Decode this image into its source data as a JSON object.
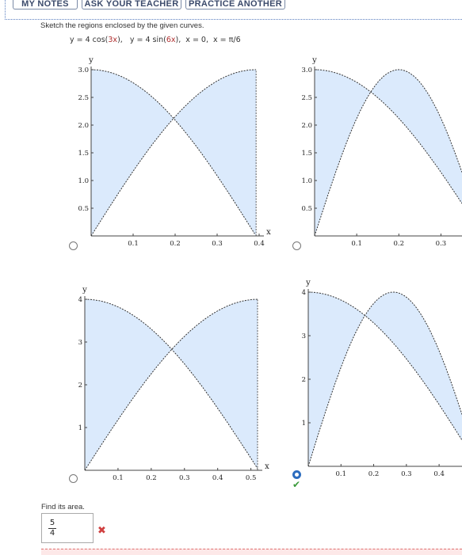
{
  "toolbar": {
    "my_notes_label": "MY NOTES",
    "ask_teacher_label": "ASK YOUR TEACHER",
    "practice_another_label": "PRACTICE ANOTHER"
  },
  "question": {
    "prompt": "Sketch the regions enclosed by the given curves.",
    "eq_y1": "y = 4 cos(",
    "eq_arg1": "3x",
    "eq_mid": "),   y = 4 sin(",
    "eq_arg2": "6x",
    "eq_rest": "),  x = 0,  x = π/6"
  },
  "options": [
    {
      "id": "a",
      "selected": false,
      "correct_mark": false,
      "chart_data": {
        "type": "area",
        "ylabel": "y",
        "xlabel": "x",
        "x_ticks": [
          "0.1",
          "0.2",
          "0.3",
          "0.4"
        ],
        "y_ticks": [
          "0.5",
          "1.0",
          "1.5",
          "2.0",
          "2.5",
          "3.0"
        ],
        "xlim": [
          0,
          0.4
        ],
        "ylim": [
          0,
          3
        ],
        "series": [
          {
            "fn": "3*cos(4x)",
            "period_scale": 4
          },
          {
            "fn": "3*sin(4x)"
          }
        ]
      }
    },
    {
      "id": "b",
      "selected": false,
      "correct_mark": false,
      "chart_data": {
        "type": "area",
        "ylabel": "y",
        "x_ticks": [
          "0.1",
          "0.2",
          "0.3"
        ],
        "y_ticks": [
          "0.5",
          "1.0",
          "1.5",
          "2.0",
          "2.5",
          "3.0"
        ],
        "xlim": [
          0,
          0.35
        ],
        "ylim": [
          0,
          3
        ]
      }
    },
    {
      "id": "c",
      "selected": false,
      "correct_mark": false,
      "chart_data": {
        "type": "area",
        "ylabel": "y",
        "xlabel": "x",
        "x_ticks": [
          "0.1",
          "0.2",
          "0.3",
          "0.4",
          "0.5"
        ],
        "y_ticks": [
          "1",
          "2",
          "3",
          "4"
        ],
        "xlim": [
          0,
          0.52
        ],
        "ylim": [
          0,
          4
        ]
      }
    },
    {
      "id": "d",
      "selected": true,
      "correct_mark": true,
      "chart_data": {
        "type": "area",
        "ylabel": "y",
        "x_ticks": [
          "0.1",
          "0.2",
          "0.3",
          "0.4"
        ],
        "y_ticks": [
          "1",
          "2",
          "3",
          "4"
        ],
        "xlim": [
          0,
          0.47
        ],
        "ylim": [
          0,
          4
        ]
      }
    }
  ],
  "area": {
    "label": "Find its area.",
    "answer_num": "5",
    "answer_den": "4",
    "status": "incorrect"
  },
  "colors": {
    "fill": "#dbeafc",
    "curve": "#333333",
    "selected_radio": "#2d6dbf",
    "check": "#3a9a3a",
    "wrong": "#d04040"
  }
}
